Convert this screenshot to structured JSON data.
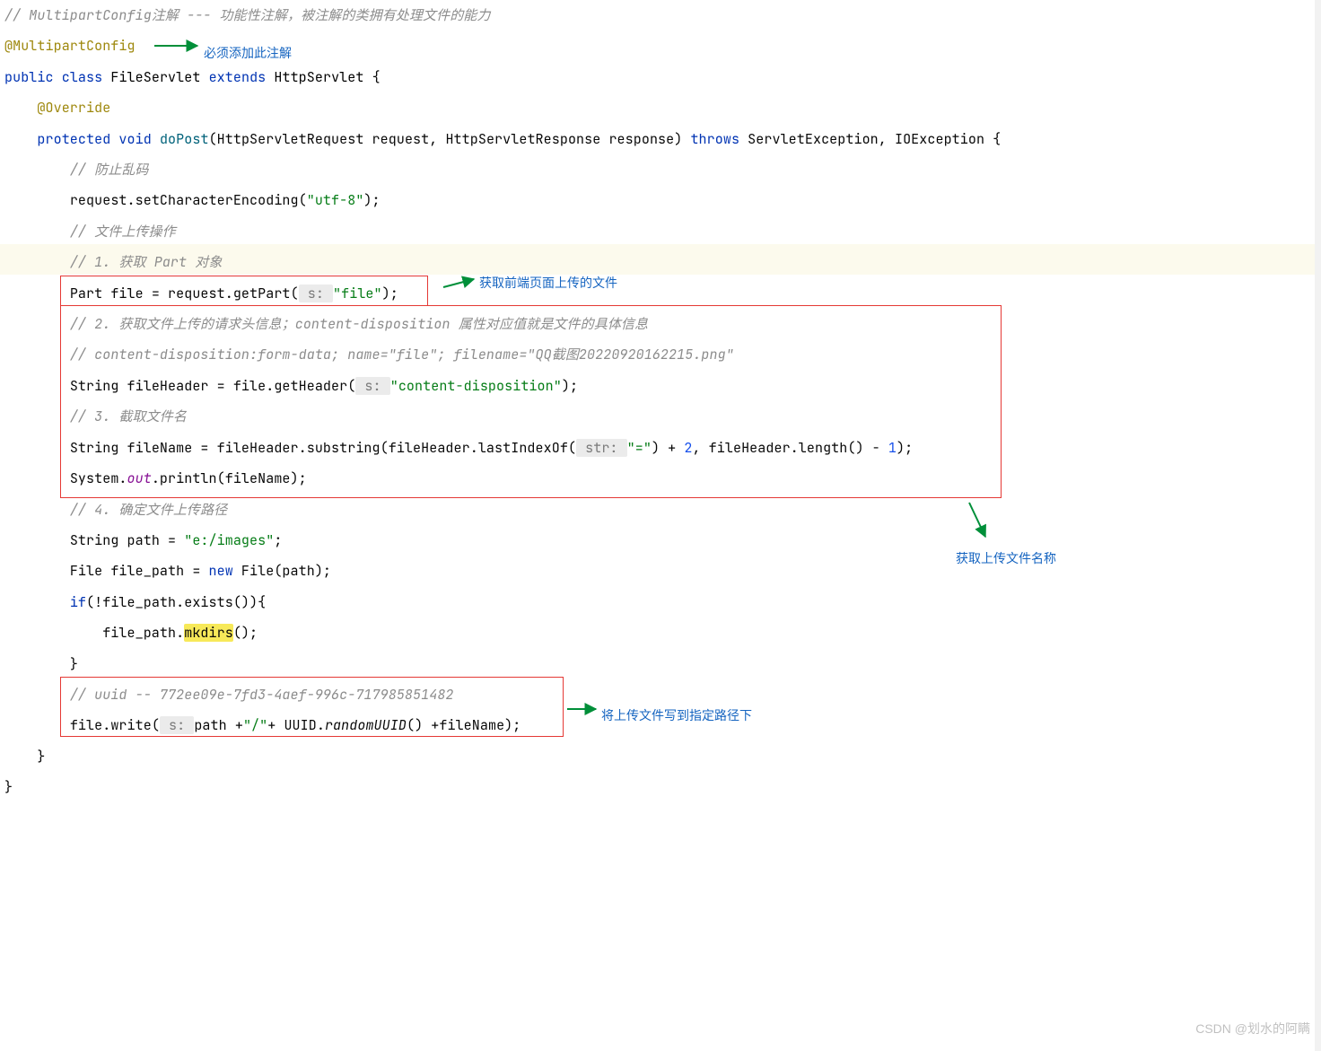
{
  "code": {
    "c0": "// MultipartConfig注解 --- 功能性注解，被注解的类拥有处理文件的能力",
    "c1": "@MultipartConfig",
    "kw_public": "public",
    "kw_class": "class",
    "ty_FileServlet": "FileServlet",
    "kw_extends": "extends",
    "ty_HttpServlet": "HttpServlet",
    "ann_Override": "@Override",
    "kw_protected": "protected",
    "kw_void": "void",
    "fn_doPost": "doPost",
    "sig1": "(HttpServletRequest request, HttpServletResponse response) ",
    "kw_throws": "throws",
    "sig2": " ServletException, IOException {",
    "c_prevent": "// 防止乱码",
    "l_setEnc_a": "request.setCharacterEncoding(",
    "str_utf8": "\"utf-8\"",
    "l_setEnc_b": ");",
    "c_upload": "// 文件上传操作",
    "c_getPart": "// 1. 获取 Part 对象",
    "l_getPart_a": "Part file = request.getPart(",
    "hint_s": " s: ",
    "str_file": "\"file\"",
    "l_getPart_b": ");",
    "c_header1": "// 2. 获取文件上传的请求头信息；content-disposition 属性对应值就是文件的具体信息",
    "c_header2": "// content-disposition:form-data; name=\"file\"; filename=\"QQ截图20220920162215.png\"",
    "l_hdr_a": "String fileHeader = file.getHeader(",
    "str_cd": "\"content-disposition\"",
    "l_hdr_b": ");",
    "c_cut": "// 3. 截取文件名",
    "l_sub_a": "String fileName = fileHeader.substring(fileHeader.lastIndexOf(",
    "hint_str": " str: ",
    "str_eq": "\"=\"",
    "l_sub_b": ") + ",
    "num_2": "2",
    "l_sub_c": ", fileHeader.length() - ",
    "num_1": "1",
    "l_sub_d": ");",
    "l_sout_a": "System.",
    "fd_out": "out",
    "l_sout_b": ".println(fileName);",
    "c_path": "// 4. 确定文件上传路径",
    "l_path_a": "String path = ",
    "str_path": "\"e:/images\"",
    "l_path_b": ";",
    "l_file_a": "File file_path = ",
    "kw_new": "new",
    "l_file_b": " File(path);",
    "kw_if": "if",
    "l_if_a": "(!file_path.exists()){",
    "l_mk_a": "file_path.",
    "fn_mkdirs": "mkdirs",
    "l_mk_b": "();",
    "brace_close": "}",
    "c_uuid": "// uuid -- 772ee09e-7fd3-4aef-996c-717985851482",
    "l_wr_a": "file.write(",
    "l_wr_b": "path +",
    "str_slash": "\"/\"",
    "l_wr_c": "+ UUID.",
    "fn_random": "randomUUID",
    "l_wr_d": "() +fileName);"
  },
  "annotations": {
    "a1": "必须添加此注解",
    "a2": "获取前端页面上传的文件",
    "a3": "获取上传文件名称",
    "a4": "将上传文件写到指定路径下"
  },
  "watermark": "CSDN @划水的阿瞒"
}
